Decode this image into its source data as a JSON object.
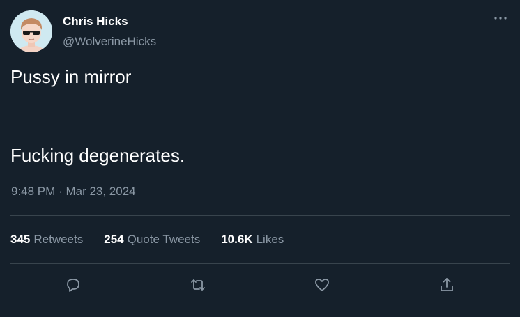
{
  "author": {
    "name": "Chris Hicks",
    "handle": "@WolverineHicks"
  },
  "tweet": {
    "lines": [
      "Pussy in mirror",
      "Fucking degenerates."
    ],
    "time": "9:48 PM",
    "separator": "·",
    "date": "Mar 23, 2024"
  },
  "stats": {
    "retweets": {
      "count": "345",
      "label": "Retweets"
    },
    "quotes": {
      "count": "254",
      "label": "Quote Tweets"
    },
    "likes": {
      "count": "10.6K",
      "label": "Likes"
    }
  },
  "icons": {
    "more": "more-horizontal-icon",
    "reply": "reply-icon",
    "retweet": "retweet-icon",
    "like": "like-icon",
    "share": "share-icon"
  },
  "colors": {
    "background": "#15202b",
    "primary_text": "#ffffff",
    "secondary_text": "#8b98a5",
    "divider": "#38444d"
  }
}
